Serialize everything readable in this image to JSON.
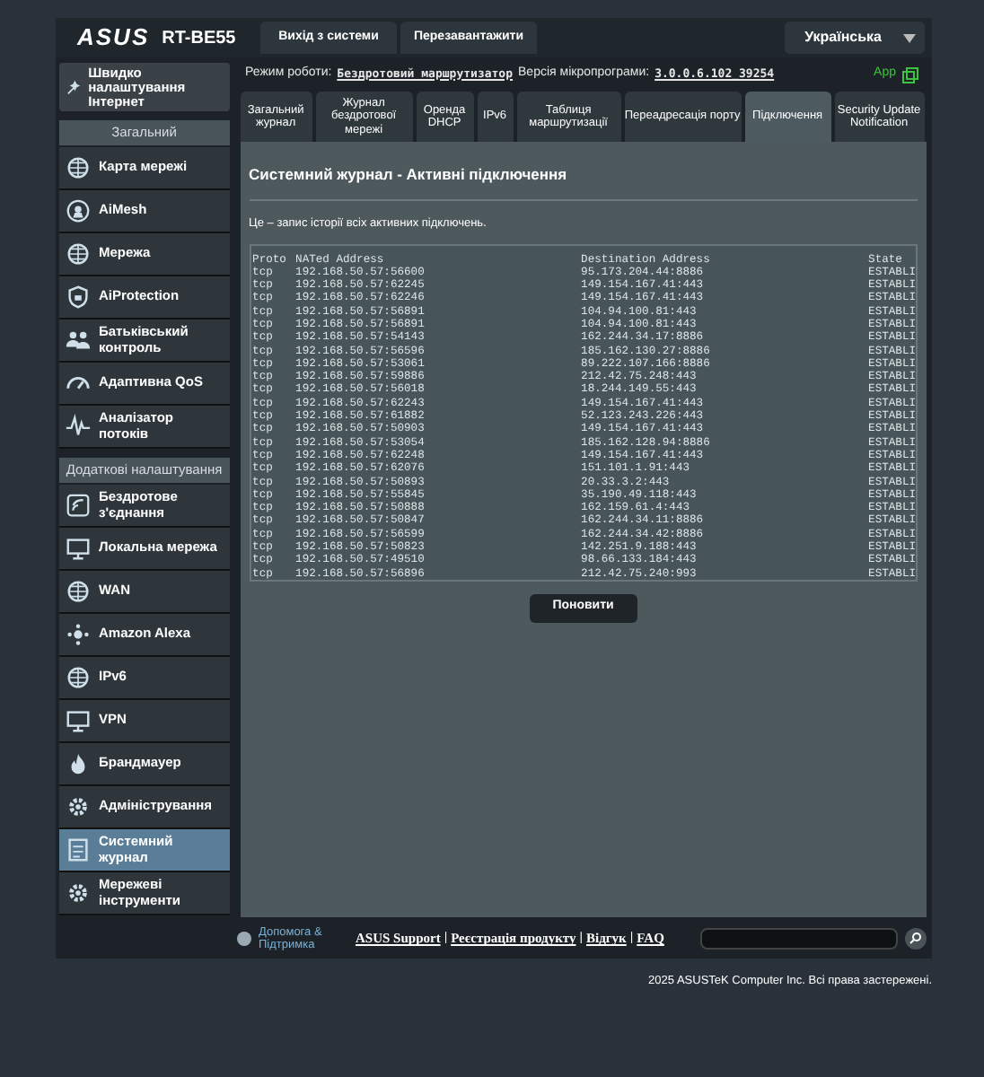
{
  "header": {
    "logo": "ASUS",
    "model": "RT-BE55",
    "buttons": [
      "Вихід з системи",
      "Перезавантажити"
    ],
    "language": "Українська"
  },
  "info_bar": {
    "mode_label": "Режим роботи:",
    "mode": "Бездротовий маршрутизатор",
    "firmware_label": "Версія мікропрограми:",
    "firmware": "3.0.0.6.102_39254",
    "app": "App"
  },
  "sidebar": {
    "quick_setup": "Швидко налаштування Інтернет",
    "sections": [
      {
        "title": "Загальний",
        "items": [
          {
            "label": "Карта мережі",
            "selected": false
          },
          {
            "label": "AiMesh",
            "selected": false
          },
          {
            "label": "Мережа",
            "selected": false
          },
          {
            "label": "AiProtection",
            "selected": false
          },
          {
            "label": "Батьківський контроль",
            "selected": false
          },
          {
            "label": "Адаптивна QoS",
            "selected": false
          },
          {
            "label": "Аналізатор потоків",
            "selected": false
          }
        ]
      },
      {
        "title": "Додаткові налаштування",
        "items": [
          {
            "label": "Бездротове з'єднання",
            "selected": false
          },
          {
            "label": "Локальна мережа",
            "selected": false
          },
          {
            "label": "WAN",
            "selected": false
          },
          {
            "label": "Amazon Alexa",
            "selected": false
          },
          {
            "label": "IPv6",
            "selected": false
          },
          {
            "label": "VPN",
            "selected": false
          },
          {
            "label": "Брандмауер",
            "selected": false
          },
          {
            "label": "Адміністрування",
            "selected": false
          },
          {
            "label": "Системний журнал",
            "selected": true
          },
          {
            "label": "Мережеві інструменти",
            "selected": false
          }
        ]
      }
    ]
  },
  "tabs": [
    {
      "label": "Загальний журнал",
      "selected": false
    },
    {
      "label": "Журнал бездротової мережі",
      "selected": false
    },
    {
      "label": "Оренда DHCP",
      "selected": false
    },
    {
      "label": "IPv6",
      "selected": false
    },
    {
      "label": "Таблиця маршрутизації",
      "selected": false
    },
    {
      "label": "Переадресація порту",
      "selected": false
    },
    {
      "label": "Підключення",
      "selected": true
    },
    {
      "label": "Security Update Notification",
      "selected": false
    }
  ],
  "page": {
    "title": "Системний журнал - Активні підключення",
    "description": "Це – запис історії всіх активних підключень.",
    "columns": [
      "Proto",
      "NATed Address",
      "Destination Address",
      "State"
    ],
    "rows": [
      [
        "tcp",
        "192.168.50.57:56600",
        "95.173.204.44:8886",
        "ESTABLI"
      ],
      [
        "tcp",
        "192.168.50.57:62245",
        "149.154.167.41:443",
        "ESTABLI"
      ],
      [
        "tcp",
        "192.168.50.57:62246",
        "149.154.167.41:443",
        "ESTABLI"
      ],
      [
        "tcp",
        "192.168.50.57:56891",
        "104.94.100.81:443",
        "ESTABLI"
      ],
      [
        "tcp",
        "192.168.50.57:56891",
        "104.94.100.81:443",
        "ESTABLI"
      ],
      [
        "tcp",
        "192.168.50.57:54143",
        "162.244.34.17:8886",
        "ESTABLI"
      ],
      [
        "tcp",
        "192.168.50.57:56596",
        "185.162.130.27:8886",
        "ESTABLI"
      ],
      [
        "tcp",
        "192.168.50.57:53061",
        "89.222.107.166:8886",
        "ESTABLI"
      ],
      [
        "tcp",
        "192.168.50.57:59886",
        "212.42.75.248:443",
        "ESTABLI"
      ],
      [
        "tcp",
        "192.168.50.57:56018",
        "18.244.149.55:443",
        "ESTABLI"
      ],
      [
        "tcp",
        "192.168.50.57:62243",
        "149.154.167.41:443",
        "ESTABLI"
      ],
      [
        "tcp",
        "192.168.50.57:61882",
        "52.123.243.226:443",
        "ESTABLI"
      ],
      [
        "tcp",
        "192.168.50.57:50903",
        "149.154.167.41:443",
        "ESTABLI"
      ],
      [
        "tcp",
        "192.168.50.57:53054",
        "185.162.128.94:8886",
        "ESTABLI"
      ],
      [
        "tcp",
        "192.168.50.57:62248",
        "149.154.167.41:443",
        "ESTABLI"
      ],
      [
        "tcp",
        "192.168.50.57:62076",
        "151.101.1.91:443",
        "ESTABLI"
      ],
      [
        "tcp",
        "192.168.50.57:50893",
        "20.33.3.2:443",
        "ESTABLI"
      ],
      [
        "tcp",
        "192.168.50.57:55845",
        "35.190.49.118:443",
        "ESTABLI"
      ],
      [
        "tcp",
        "192.168.50.57:50888",
        "162.159.61.4:443",
        "ESTABLI"
      ],
      [
        "tcp",
        "192.168.50.57:50847",
        "162.244.34.11:8886",
        "ESTABLI"
      ],
      [
        "tcp",
        "192.168.50.57:56599",
        "162.244.34.42:8886",
        "ESTABLI"
      ],
      [
        "tcp",
        "192.168.50.57:50823",
        "142.251.9.188:443",
        "ESTABLI"
      ],
      [
        "tcp",
        "192.168.50.57:49510",
        "98.66.133.184:443",
        "ESTABLI"
      ],
      [
        "tcp",
        "192.168.50.57:56896",
        "212.42.75.240:993",
        "ESTABLI"
      ]
    ],
    "refresh_button": "Поновити"
  },
  "footer": {
    "help": "Допомога & Підтримка",
    "links": [
      "ASUS Support",
      "Реєстрація продукту",
      "Відгук",
      "FAQ"
    ],
    "separators": [
      "|",
      "|",
      "|"
    ],
    "copyright": "2025 ASUSTeK Computer Inc. Всі права застережені."
  }
}
